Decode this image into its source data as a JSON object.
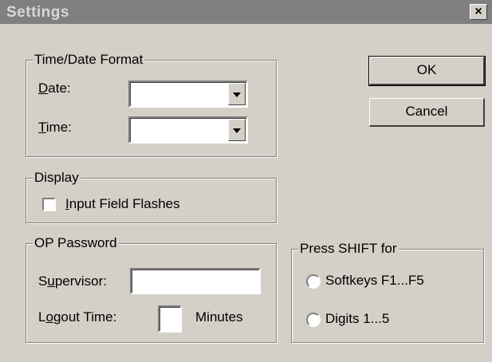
{
  "window": {
    "title": "Settings",
    "close_label": "×"
  },
  "time_date_format": {
    "legend": "Time/Date Format",
    "date_label_u": "D",
    "date_label_rest": "ate:",
    "date_value": "",
    "time_label_u": "T",
    "time_label_rest": "ime:",
    "time_value": ""
  },
  "display": {
    "legend": "Display",
    "checkbox_u": "I",
    "checkbox_rest": "nput Field Flashes",
    "checked": false
  },
  "op_password": {
    "legend": "OP Password",
    "supervisor_pre": "S",
    "supervisor_u": "u",
    "supervisor_rest": "pervisor:",
    "supervisor_value": "",
    "logout_pre": "L",
    "logout_u": "o",
    "logout_rest": "gout Time:",
    "logout_value": "",
    "minutes_label": "Minutes"
  },
  "press_shift": {
    "legend": "Press SHIFT for",
    "option1": "Softkeys F1...F5",
    "option2": "Digits 1...5"
  },
  "buttons": {
    "ok": "OK",
    "cancel": "Cancel"
  }
}
